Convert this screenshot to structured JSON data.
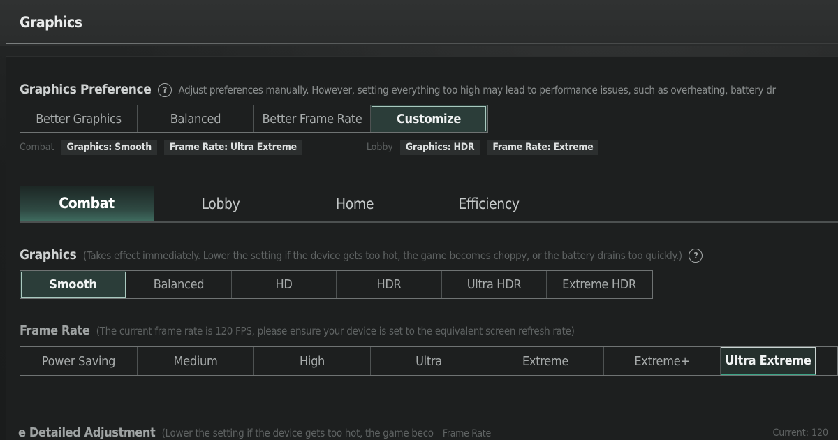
{
  "header": {
    "title": "Graphics"
  },
  "preference": {
    "label": "Graphics Preference",
    "help_icon": "question-circle-icon",
    "description": "Adjust preferences manually. However, setting everything too high may lead to performance issues, such as overheating, battery dr",
    "options": [
      "Better Graphics",
      "Balanced",
      "Better Frame Rate",
      "Customize"
    ],
    "selected": "Customize"
  },
  "summary": {
    "combat_label": "Combat",
    "combat_chips": [
      "Graphics: Smooth",
      "Frame Rate: Ultra Extreme"
    ],
    "lobby_label": "Lobby",
    "lobby_chips": [
      "Graphics: HDR",
      "Frame Rate: Extreme"
    ]
  },
  "tabs": {
    "items": [
      "Combat",
      "Lobby",
      "Home",
      "Efficiency"
    ],
    "active": "Combat"
  },
  "graphics": {
    "label": "Graphics",
    "description": "(Takes effect immediately. Lower the setting if the device gets too hot, the game becomes choppy, or the battery drains too quickly.)",
    "help_icon": "question-circle-icon",
    "options": [
      "Smooth",
      "Balanced",
      "HD",
      "HDR",
      "Ultra HDR",
      "Extreme HDR"
    ],
    "selected": "Smooth"
  },
  "frame_rate": {
    "label": "Frame Rate",
    "description": "(The current frame rate is 120 FPS, please ensure your device is set to the equivalent screen refresh rate)",
    "options": [
      "Power Saving",
      "Medium",
      "High",
      "Ultra",
      "Extreme",
      "Extreme+",
      "Ultra Extreme"
    ],
    "selected": "Ultra Extreme"
  },
  "detailed": {
    "label": "e Detailed Adjustment",
    "description": "(Lower the setting if the device gets too hot, the game beco",
    "sub_label": "Frame Rate",
    "current": "Current: 120"
  },
  "colors": {
    "accent": "#6fcaa8",
    "selected_bg": "#2b3d39",
    "background": "#1c1e1e"
  }
}
